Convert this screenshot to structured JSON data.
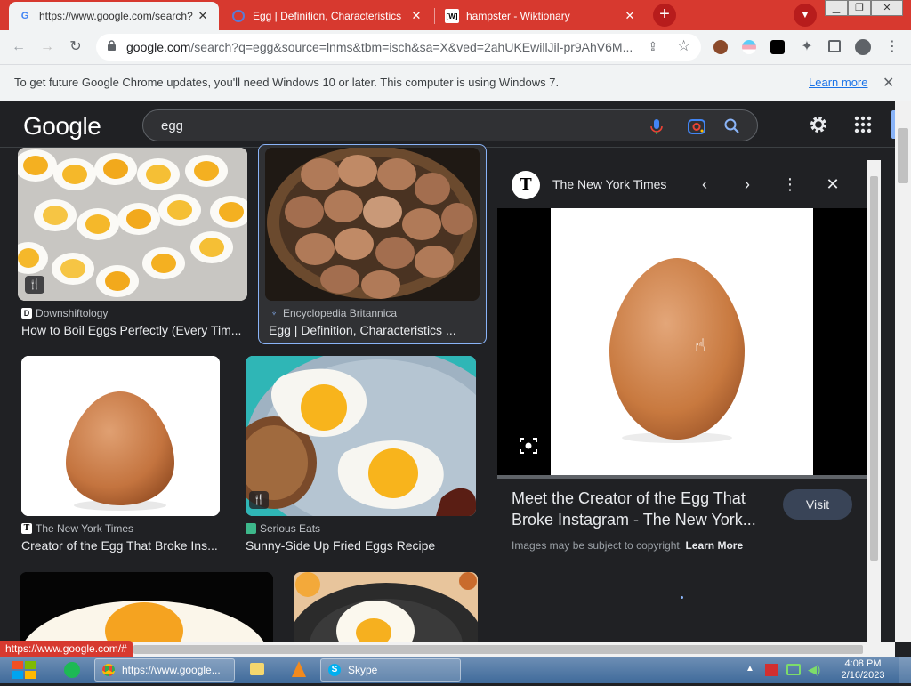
{
  "browser": {
    "tabs": [
      {
        "title": "https://www.google.com/search?",
        "favicon": "G",
        "active": true
      },
      {
        "title": "Egg | Definition, Characteristics",
        "favicon": "",
        "active": false
      },
      {
        "title": "hampster - Wiktionary",
        "favicon": "[W]",
        "active": false
      }
    ],
    "new_tab": "+",
    "url_host": "google.com",
    "url_rest": "/search?q=egg&source=lnms&tbm=isch&sa=X&ved=2ahUKEwillJil-pr9AhV6M...",
    "accent": "#d7392f"
  },
  "infobar": {
    "message": "To get future Google Chrome updates, you'll need Windows 10 or later. This computer is using Windows 7.",
    "link": "Learn more"
  },
  "google": {
    "logo": "Google",
    "query": "egg"
  },
  "results": [
    {
      "source": "Downshiftology",
      "caption": "How to Boil Eggs Perfectly (Every Tim..."
    },
    {
      "source": "Encyclopedia Britannica",
      "caption": "Egg | Definition, Characteristics ..."
    },
    {
      "source": "The New York Times",
      "caption": "Creator of the Egg That Broke Ins..."
    },
    {
      "source": "Serious Eats",
      "caption": "Sunny-Side Up Fried Eggs Recipe"
    }
  ],
  "panel": {
    "source": "The New York Times",
    "title": "Meet the Creator of the Egg That Broke Instagram - The New York...",
    "visit": "Visit",
    "copyright": "Images may be subject to copyright.",
    "learn_more": "Learn More"
  },
  "status_url": "https://www.google.com/#",
  "taskbar": {
    "chrome_task": "https://www.google...",
    "skype_task": "Skype",
    "time": "4:08 PM",
    "date": "2/16/2023"
  }
}
